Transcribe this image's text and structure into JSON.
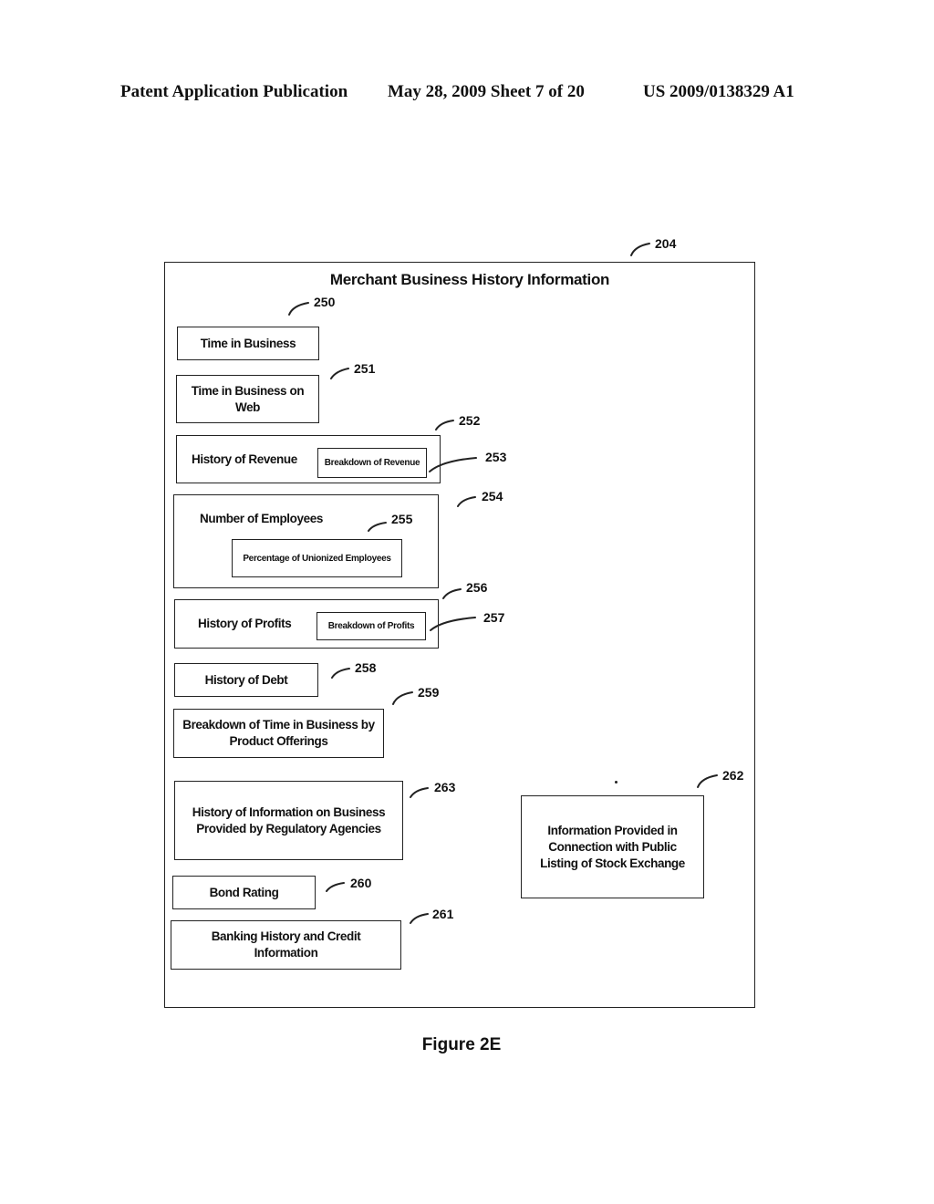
{
  "header": {
    "publication": "Patent Application Publication",
    "date_sheet": "May 28, 2009  Sheet 7 of 20",
    "patent_number": "US 2009/0138329 A1"
  },
  "diagram": {
    "ref": "204",
    "title": "Merchant Business History Information",
    "blocks": [
      {
        "id": "250",
        "label": "Time in Business"
      },
      {
        "id": "251",
        "label": "Time in Business on Web"
      },
      {
        "id": "252",
        "label": "History of Revenue",
        "child": {
          "id": "253",
          "label": "Breakdown of Revenue"
        }
      },
      {
        "id": "254",
        "label": "Number of Employees",
        "child": {
          "id": "255",
          "label": "Percentage of Unionized Employees"
        }
      },
      {
        "id": "256",
        "label": "History of Profits",
        "child": {
          "id": "257",
          "label": "Breakdown of Profits"
        }
      },
      {
        "id": "258",
        "label": "History of Debt"
      },
      {
        "id": "259",
        "label": "Breakdown of Time in Business by Product Offerings"
      },
      {
        "id": "263",
        "label": "History of Information on Business Provided by Regulatory Agencies"
      },
      {
        "id": "260",
        "label": "Bond Rating"
      },
      {
        "id": "261",
        "label": "Banking History and Credit Information"
      },
      {
        "id": "262",
        "label": "Information Provided in Connection with Public Listing of Stock Exchange"
      }
    ]
  },
  "caption": "Figure 2E"
}
